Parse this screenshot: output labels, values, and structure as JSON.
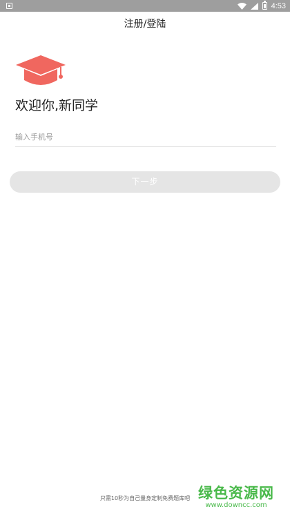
{
  "status_bar": {
    "time": "4:53",
    "icons": [
      "notification-icon",
      "wifi-icon",
      "signal-icon",
      "battery-icon"
    ]
  },
  "header": {
    "title": "注册/登陆"
  },
  "logo": {
    "icon": "graduation-cap-icon",
    "color": "#f0675f"
  },
  "welcome": {
    "text": "欢迎你,新同学"
  },
  "form": {
    "phone_placeholder": "输入手机号",
    "phone_value": "",
    "next_button_label": "下一步",
    "next_button_color": "#e5e5e5"
  },
  "footer": {
    "text": "只需10秒为自己量身定制免费题库吧"
  },
  "watermark": {
    "main": "绿色资源网",
    "url": "www.downcc.com",
    "color": "#49b94a"
  }
}
